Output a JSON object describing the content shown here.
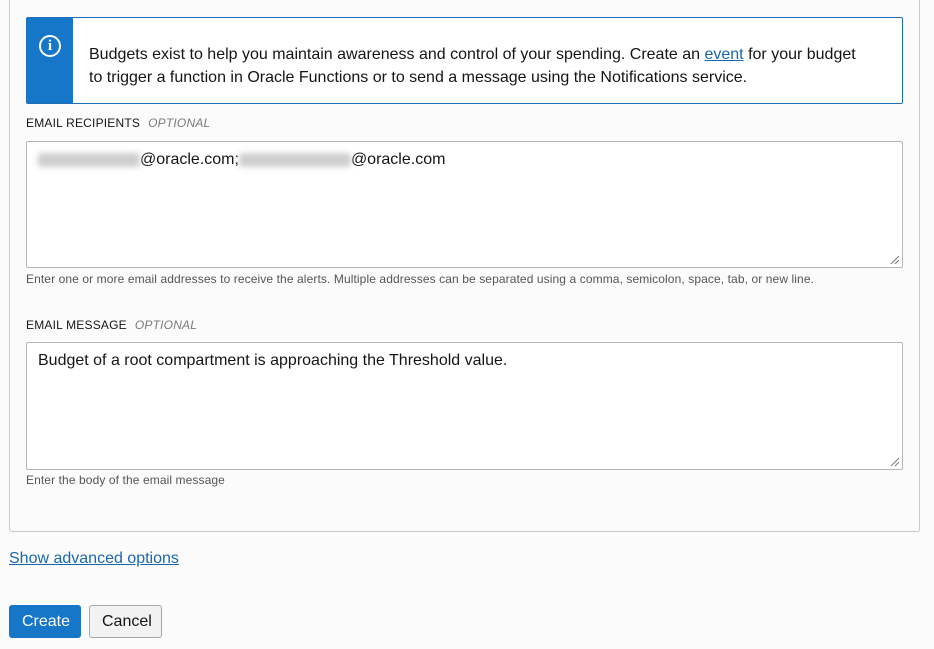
{
  "info": {
    "text_before_link": "Budgets exist to help you maintain awareness and control of your spending. Create an ",
    "link": "event",
    "text_after_link": " for your budget to trigger a function in Oracle Functions or to send a message using the Notifications service."
  },
  "email_recipients": {
    "label": "EMAIL RECIPIENTS",
    "optional": "OPTIONAL",
    "value_part1": "@oracle.com;",
    "value_part2": "@oracle.com",
    "hint": "Enter one or more email addresses to receive the alerts. Multiple addresses can be separated using a comma, semicolon, space, tab, or new line."
  },
  "email_message": {
    "label": "EMAIL MESSAGE",
    "optional": "OPTIONAL",
    "value": "Budget of a root compartment is approaching the Threshold value.",
    "hint": "Enter the body of the email message"
  },
  "advanced_link": "Show advanced options",
  "buttons": {
    "create": "Create",
    "cancel": "Cancel"
  }
}
